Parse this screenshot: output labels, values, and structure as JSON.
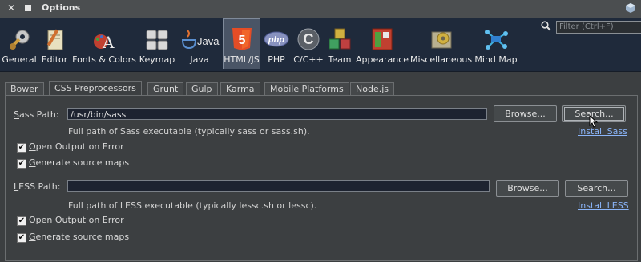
{
  "window": {
    "title": "Options"
  },
  "filter": {
    "placeholder": "Filter (Ctrl+F)"
  },
  "categories": [
    {
      "label": "General",
      "icon": "wrench-gear-icon"
    },
    {
      "label": "Editor",
      "icon": "pencil-notepad-icon"
    },
    {
      "label": "Fonts & Colors",
      "icon": "font-palette-icon"
    },
    {
      "label": "Keymap",
      "icon": "keyboard-icon"
    },
    {
      "label": "Java",
      "icon": "java-cup-icon"
    },
    {
      "label": "HTML/JS",
      "icon": "html5-shield-icon",
      "badge": "5"
    },
    {
      "label": "PHP",
      "icon": "php-logo-icon",
      "badge": "php"
    },
    {
      "label": "C/C++",
      "icon": "c-logo-icon",
      "badge": "C"
    },
    {
      "label": "Team",
      "icon": "cubes-icon"
    },
    {
      "label": "Appearance",
      "icon": "window-layout-icon"
    },
    {
      "label": "Miscellaneous",
      "icon": "misc-box-icon"
    },
    {
      "label": "Mind Map",
      "icon": "mind-map-icon"
    }
  ],
  "tabs": [
    "Bower",
    "CSS Preprocessors",
    "Grunt",
    "Gulp",
    "Karma",
    "Mobile Platforms",
    "Node.js"
  ],
  "sass": {
    "label_first": "S",
    "label_rest": "ass Path:",
    "value": "/usr/bin/sass",
    "browse": "Browse...",
    "search": "Search...",
    "hint": "Full path of Sass executable (typically sass or sass.sh).",
    "install": "Install Sass",
    "open_output_first": "O",
    "open_output_rest": "pen Output on Error",
    "gen_maps_first": "G",
    "gen_maps_rest": "enerate source maps"
  },
  "less": {
    "label_first": "L",
    "label_rest": "ESS Path:",
    "value": "",
    "browse": "Browse...",
    "search": "Search...",
    "hint": "Full path of LESS executable (typically lessc.sh or lessc).",
    "install": "Install LESS",
    "open_output_first": "O",
    "open_output_rest": "pen Output on Error",
    "gen_maps_first": "G",
    "gen_maps_rest": "enerate source maps"
  },
  "checkbox_mark": "✔"
}
